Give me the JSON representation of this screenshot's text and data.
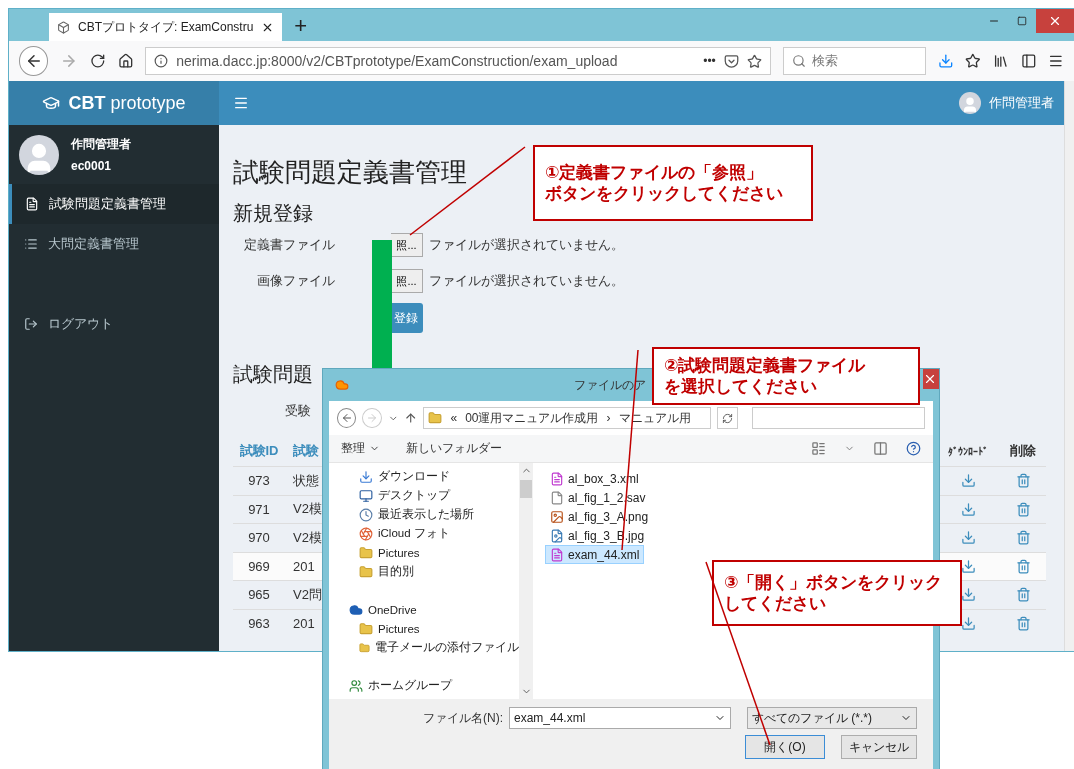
{
  "browser": {
    "tab_title": "CBTプロトタイプ: ExamConstru",
    "new_tab": "+",
    "url": "nerima.dacc.jp:8000/v2/CBTprototype/ExamConstruction/exam_upload",
    "more": "•••",
    "search_placeholder": "検索"
  },
  "app": {
    "brand": "**CBT** prototype",
    "header_user": "作問管理者"
  },
  "sidebar": {
    "user_name": "作問管理者",
    "user_id": "ec0001",
    "items": [
      {
        "label": "試験問題定義書管理",
        "kind": "doc",
        "selected": true
      },
      {
        "label": "大問定義書管理",
        "kind": "list",
        "selected": false
      },
      {
        "label": "ログアウト",
        "kind": "logout",
        "selected": false
      }
    ]
  },
  "page": {
    "title": "試験問題定義書管理",
    "form_title": "新規登録",
    "fields": [
      {
        "label": "定義書ファイル",
        "button": "照...",
        "status": "ファイルが選択されていません。"
      },
      {
        "label": "画像ファイル",
        "button": "照...",
        "status": "ファイルが選択されていません。"
      }
    ],
    "submit": "登録",
    "list_title": "試験問題",
    "filter_label": "受験"
  },
  "table": {
    "columns": [
      "試験ID",
      "試験"
    ],
    "right_columns": [
      "ﾀﾞｳﾝﾛｰﾄﾞ",
      "削除"
    ],
    "rows": [
      {
        "id": "973",
        "name": "状態",
        "selected": false
      },
      {
        "id": "971",
        "name": "V2模",
        "selected": false
      },
      {
        "id": "970",
        "name": "V2模",
        "selected": false
      },
      {
        "id": "969",
        "name": "201",
        "selected": true
      },
      {
        "id": "965",
        "name": "V2問",
        "selected": false
      },
      {
        "id": "963",
        "name": "201",
        "selected": false
      }
    ]
  },
  "dialog": {
    "title": "ファイルのア",
    "path_prefix": "«",
    "path_sep": "›",
    "path": [
      "00運用マニュアル作成用",
      "マニュアル用"
    ],
    "organize": "整理",
    "new_folder": "新しいフォルダー",
    "nav_groups": [
      {
        "items": [
          {
            "label": "ダウンロード",
            "kind": "download"
          },
          {
            "label": "デスクトップ",
            "kind": "desktop"
          },
          {
            "label": "最近表示した場所",
            "kind": "recent"
          },
          {
            "label": "iCloud フォト",
            "kind": "photos"
          },
          {
            "label": "Pictures",
            "kind": "folder"
          },
          {
            "label": "目的別",
            "kind": "folder"
          }
        ]
      },
      {
        "items": [
          {
            "label": "OneDrive",
            "kind": "onedrive"
          },
          {
            "label": "Pictures",
            "kind": "folder"
          },
          {
            "label": "電子メールの添付ファイル",
            "kind": "folder"
          }
        ]
      },
      {
        "items": [
          {
            "label": "ホームグループ",
            "kind": "homegroup"
          }
        ]
      }
    ],
    "files": [
      {
        "name": "al_box_3.xml",
        "kind": "xml",
        "selected": false
      },
      {
        "name": "al_fig_1_2.sav",
        "kind": "blank",
        "selected": false
      },
      {
        "name": "al_fig_3_A.png",
        "kind": "png",
        "selected": false
      },
      {
        "name": "al_fig_3_B.jpg",
        "kind": "jpg",
        "selected": false
      },
      {
        "name": "exam_44.xml",
        "kind": "xml",
        "selected": true
      }
    ],
    "filename_label": "ファイル名(N):",
    "filename": "exam_44.xml",
    "filter": "すべてのファイル (*.*)",
    "open_button": "開く(O)",
    "cancel_button": "キャンセル"
  },
  "callouts": [
    {
      "lines": [
        "①定義書ファイルの「参照」",
        "ボタンをクリックしてください"
      ]
    },
    {
      "lines": [
        "②試験問題定義書ファイル",
        "を選択してください"
      ]
    },
    {
      "lines": [
        "③「開く」ボタンをクリック",
        "してください"
      ]
    }
  ]
}
